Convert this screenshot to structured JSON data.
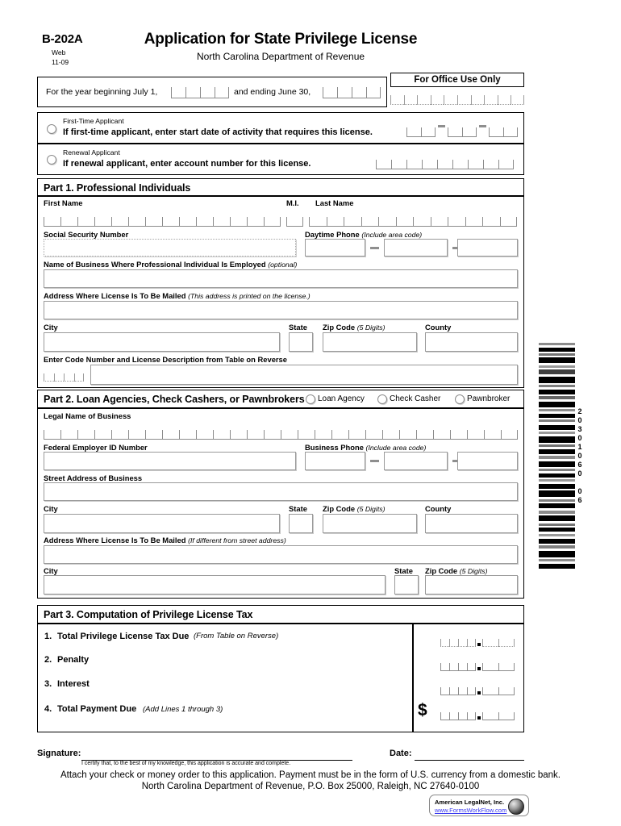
{
  "header": {
    "form_number": "B-202A",
    "web": "Web",
    "revision": "11-09",
    "title": "Application for State Privilege License",
    "subtitle": "North Carolina Department of Revenue"
  },
  "year_row": {
    "begin_label": "For the year beginning July 1,",
    "end_label": "and ending June 30,",
    "begin_value": "",
    "end_value": ""
  },
  "office": {
    "title": "For Office Use Only",
    "value": ""
  },
  "applicant": {
    "first_time": {
      "small_label": "First-Time Applicant",
      "bold_label": "If first-time applicant, enter start date of activity that requires this license.",
      "month": "",
      "day": "",
      "year": ""
    },
    "renewal": {
      "small_label": "Renewal Applicant",
      "bold_label": "If renewal applicant, enter account number for this license.",
      "account": ""
    }
  },
  "part1": {
    "title": "Part 1. Professional Individuals",
    "first_name_label": "First Name",
    "mi_label": "M.I.",
    "last_name_label": "Last Name",
    "first_name": "",
    "mi": "",
    "last_name": "",
    "ssn_label": "Social Security Number",
    "ssn": "",
    "phone_label": "Daytime Phone",
    "phone_hint": "(Include area code)",
    "phone_1": "",
    "phone_2": "",
    "phone_3": "",
    "business_label": "Name of Business Where Professional Individual Is Employed",
    "business_hint": "(optional)",
    "business": "",
    "address_label": "Address Where License Is To Be Mailed",
    "address_hint": "(This address is printed on the license.)",
    "address": "",
    "city_label": "City",
    "state_label": "State",
    "zip_label": "Zip Code",
    "zip_hint": "(5 Digits)",
    "county_label": "County",
    "city": "",
    "state": "",
    "zip": "",
    "county": "",
    "code_label": "Enter Code Number and License Description from Table on Reverse",
    "code_number": "",
    "code_description": ""
  },
  "part2": {
    "title": "Part 2.  Loan Agencies, Check Cashers, or Pawnbrokers",
    "options": [
      "Loan Agency",
      "Check Casher",
      "Pawnbroker"
    ],
    "legal_name_label": "Legal Name of Business",
    "legal_name": "",
    "fein_label": "Federal Employer ID Number",
    "fein": "",
    "phone_label": "Business Phone",
    "phone_hint": "(Include area code)",
    "phone_1": "",
    "phone_2": "",
    "phone_3": "",
    "street_label": "Street Address of Business",
    "street": "",
    "city_label": "City",
    "state_label": "State",
    "zip_label": "Zip Code",
    "zip_hint": "(5 Digits)",
    "county_label": "County",
    "city": "",
    "state": "",
    "zip": "",
    "county": "",
    "mail_label": "Address Where License Is To Be Mailed",
    "mail_hint": "(If different from street address)",
    "mail_address": "",
    "mail_city_label": "City",
    "mail_state_label": "State",
    "mail_zip_label": "Zip Code",
    "mail_zip_hint": "(5 Digits)",
    "mail_city": "",
    "mail_state": "",
    "mail_zip": ""
  },
  "part3": {
    "title": "Part 3.  Computation of Privilege License Tax",
    "lines": [
      {
        "num": "1.",
        "label": "Total Privilege License Tax Due",
        "hint": "(From Table on Reverse)",
        "value": ""
      },
      {
        "num": "2.",
        "label": "Penalty",
        "hint": "",
        "value": ""
      },
      {
        "num": "3.",
        "label": "Interest",
        "hint": "",
        "value": ""
      },
      {
        "num": "4.",
        "label": "Total Payment Due",
        "hint": "(Add Lines 1 through 3)",
        "value": ""
      }
    ],
    "dollar_sign": "$"
  },
  "footer": {
    "signature_label": "Signature:",
    "signature_value": "",
    "date_label": "Date:",
    "date_value": "",
    "certification": "I certify that, to the best of my knowledge, this application is accurate and complete.",
    "instruction": "Attach your check or money order to this application.  Payment must be in the form of U.S. currency from a domestic bank.",
    "mailing": "North Carolina Department of Revenue,  P.O. Box 25000, Raleigh, NC 27640-0100"
  },
  "barcode": {
    "number": "20301060 06"
  },
  "legalnet": {
    "company": "American LegalNet, Inc.",
    "url": "www.FormsWorkFlow.com"
  }
}
